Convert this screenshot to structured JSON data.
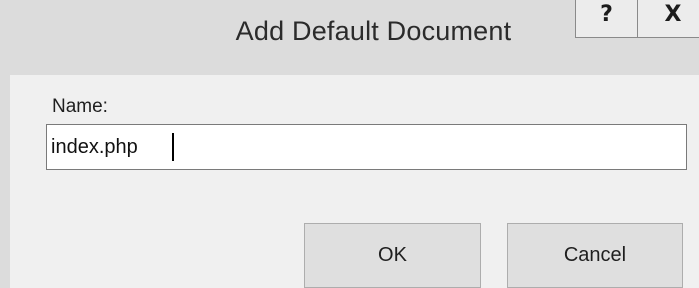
{
  "dialog": {
    "title": "Add Default Document",
    "help_glyph": "?",
    "close_glyph": "X"
  },
  "form": {
    "name_label": "Name:",
    "name_value": "index.php"
  },
  "buttons": {
    "ok_label": "OK",
    "cancel_label": "Cancel"
  },
  "colors": {
    "titlebar": "#dcdcdc",
    "body": "#f0f0f0",
    "button_face": "#dfdfdf"
  }
}
